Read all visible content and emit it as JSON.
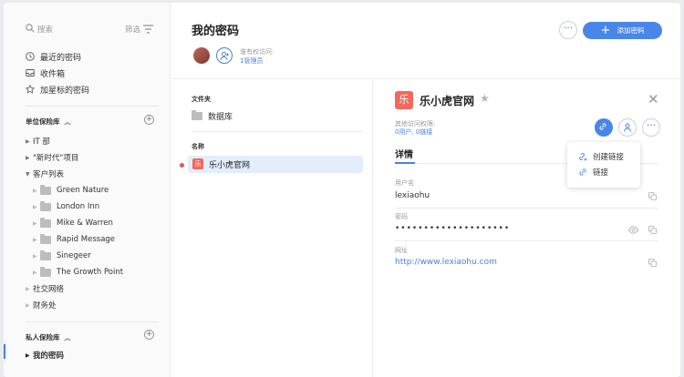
{
  "sidebar": {
    "search_placeholder": "搜索",
    "filter_label": "筛选",
    "nav": [
      {
        "label": "最近的密码",
        "icon": "clock-icon"
      },
      {
        "label": "收件箱",
        "icon": "inbox-icon"
      },
      {
        "label": "加星标的密码",
        "icon": "star-icon"
      }
    ],
    "org_vault_title": "单位保险库",
    "tree": [
      {
        "label": "IT 部",
        "level": 0,
        "expanded": false
      },
      {
        "label": "\"新时代\"项目",
        "level": 0,
        "expanded": false
      },
      {
        "label": "客户列表",
        "level": 0,
        "expanded": true
      },
      {
        "label": "Green Nature",
        "level": 1,
        "folder": true
      },
      {
        "label": "London Inn",
        "level": 1,
        "folder": true
      },
      {
        "label": "Mike & Warren",
        "level": 1,
        "folder": true
      },
      {
        "label": "Rapid Message",
        "level": 1,
        "folder": true
      },
      {
        "label": "Sinegeer",
        "level": 1,
        "folder": true
      },
      {
        "label": "The Growth Point",
        "level": 1,
        "folder": true
      },
      {
        "label": "社交网络",
        "level": 0,
        "expanded": false
      },
      {
        "label": "财务处",
        "level": 0,
        "expanded": false
      }
    ],
    "private_vault_title": "私人保险库",
    "private_item": "我的密码"
  },
  "header": {
    "title": "我的密码",
    "access_label": "谁有权访问:",
    "access_value": "1管理员",
    "add_button": "添加密码"
  },
  "list": {
    "folder_header": "文件夹",
    "folder_item": "数据库",
    "name_header": "名称",
    "selected_item": "乐小虎官网",
    "item_icon_char": "乐"
  },
  "detail": {
    "icon_char": "乐",
    "title": "乐小虎官网",
    "other_access_label": "其他访问权限:",
    "other_access_value": "0用户, 0链接",
    "tab": "详情",
    "fields": [
      {
        "label": "用户名",
        "value": "lexiaohu"
      },
      {
        "label": "密码",
        "value": "••••••••••••••••••••"
      },
      {
        "label": "网址",
        "value": "http://www.lexiaohu.com"
      }
    ],
    "popup": {
      "create_link": "创建链接",
      "links": "链接"
    }
  },
  "colors": {
    "accent": "#4a86e8",
    "item_icon": "#f3675c",
    "selected_row": "#e3edfb"
  }
}
